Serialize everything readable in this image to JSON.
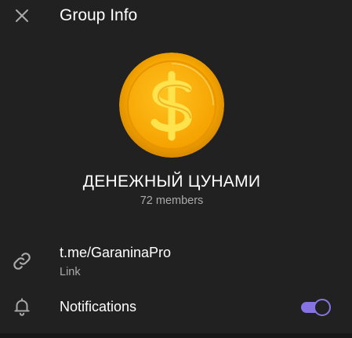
{
  "header": {
    "title": "Group Info",
    "close_icon": "close-icon"
  },
  "group": {
    "avatar_icon": "dollar-coin-icon",
    "name": "ДЕНЕЖНЫЙ ЦУНАМИ",
    "members": "72 members"
  },
  "link": {
    "icon": "link-icon",
    "value": "t.me/GaraninaPro",
    "label": "Link"
  },
  "notifications": {
    "icon": "bell-icon",
    "label": "Notifications",
    "enabled": true
  },
  "colors": {
    "background": "#212121",
    "accent": "#8774e1",
    "secondary_text": "#aaaaaa"
  }
}
